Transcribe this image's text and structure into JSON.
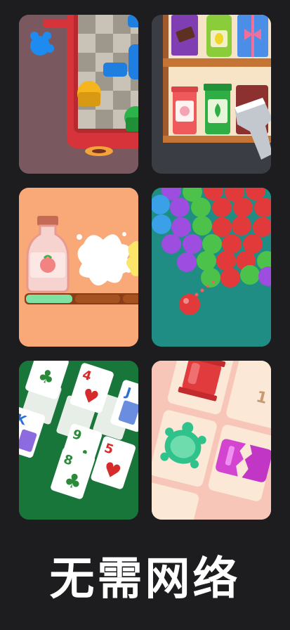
{
  "headline": "无需网络",
  "cards": {
    "solitaire": {
      "top_left": {
        "rank": "",
        "suit": "♣"
      },
      "heart_card": {
        "rank": "4",
        "suit": "♥"
      },
      "jack_card": {
        "rank": "J"
      },
      "king_card": {
        "rank": "K"
      },
      "nine_card": {
        "rank": "9",
        "suit": "♣"
      },
      "eight_card": {
        "rank": "8",
        "suit": "♣"
      },
      "five_card": {
        "rank": "5",
        "suit": "♥"
      }
    },
    "match_tile": {
      "number": "1"
    }
  },
  "colors": {
    "background": "#1d1d1f",
    "headline": "#ffffff"
  }
}
